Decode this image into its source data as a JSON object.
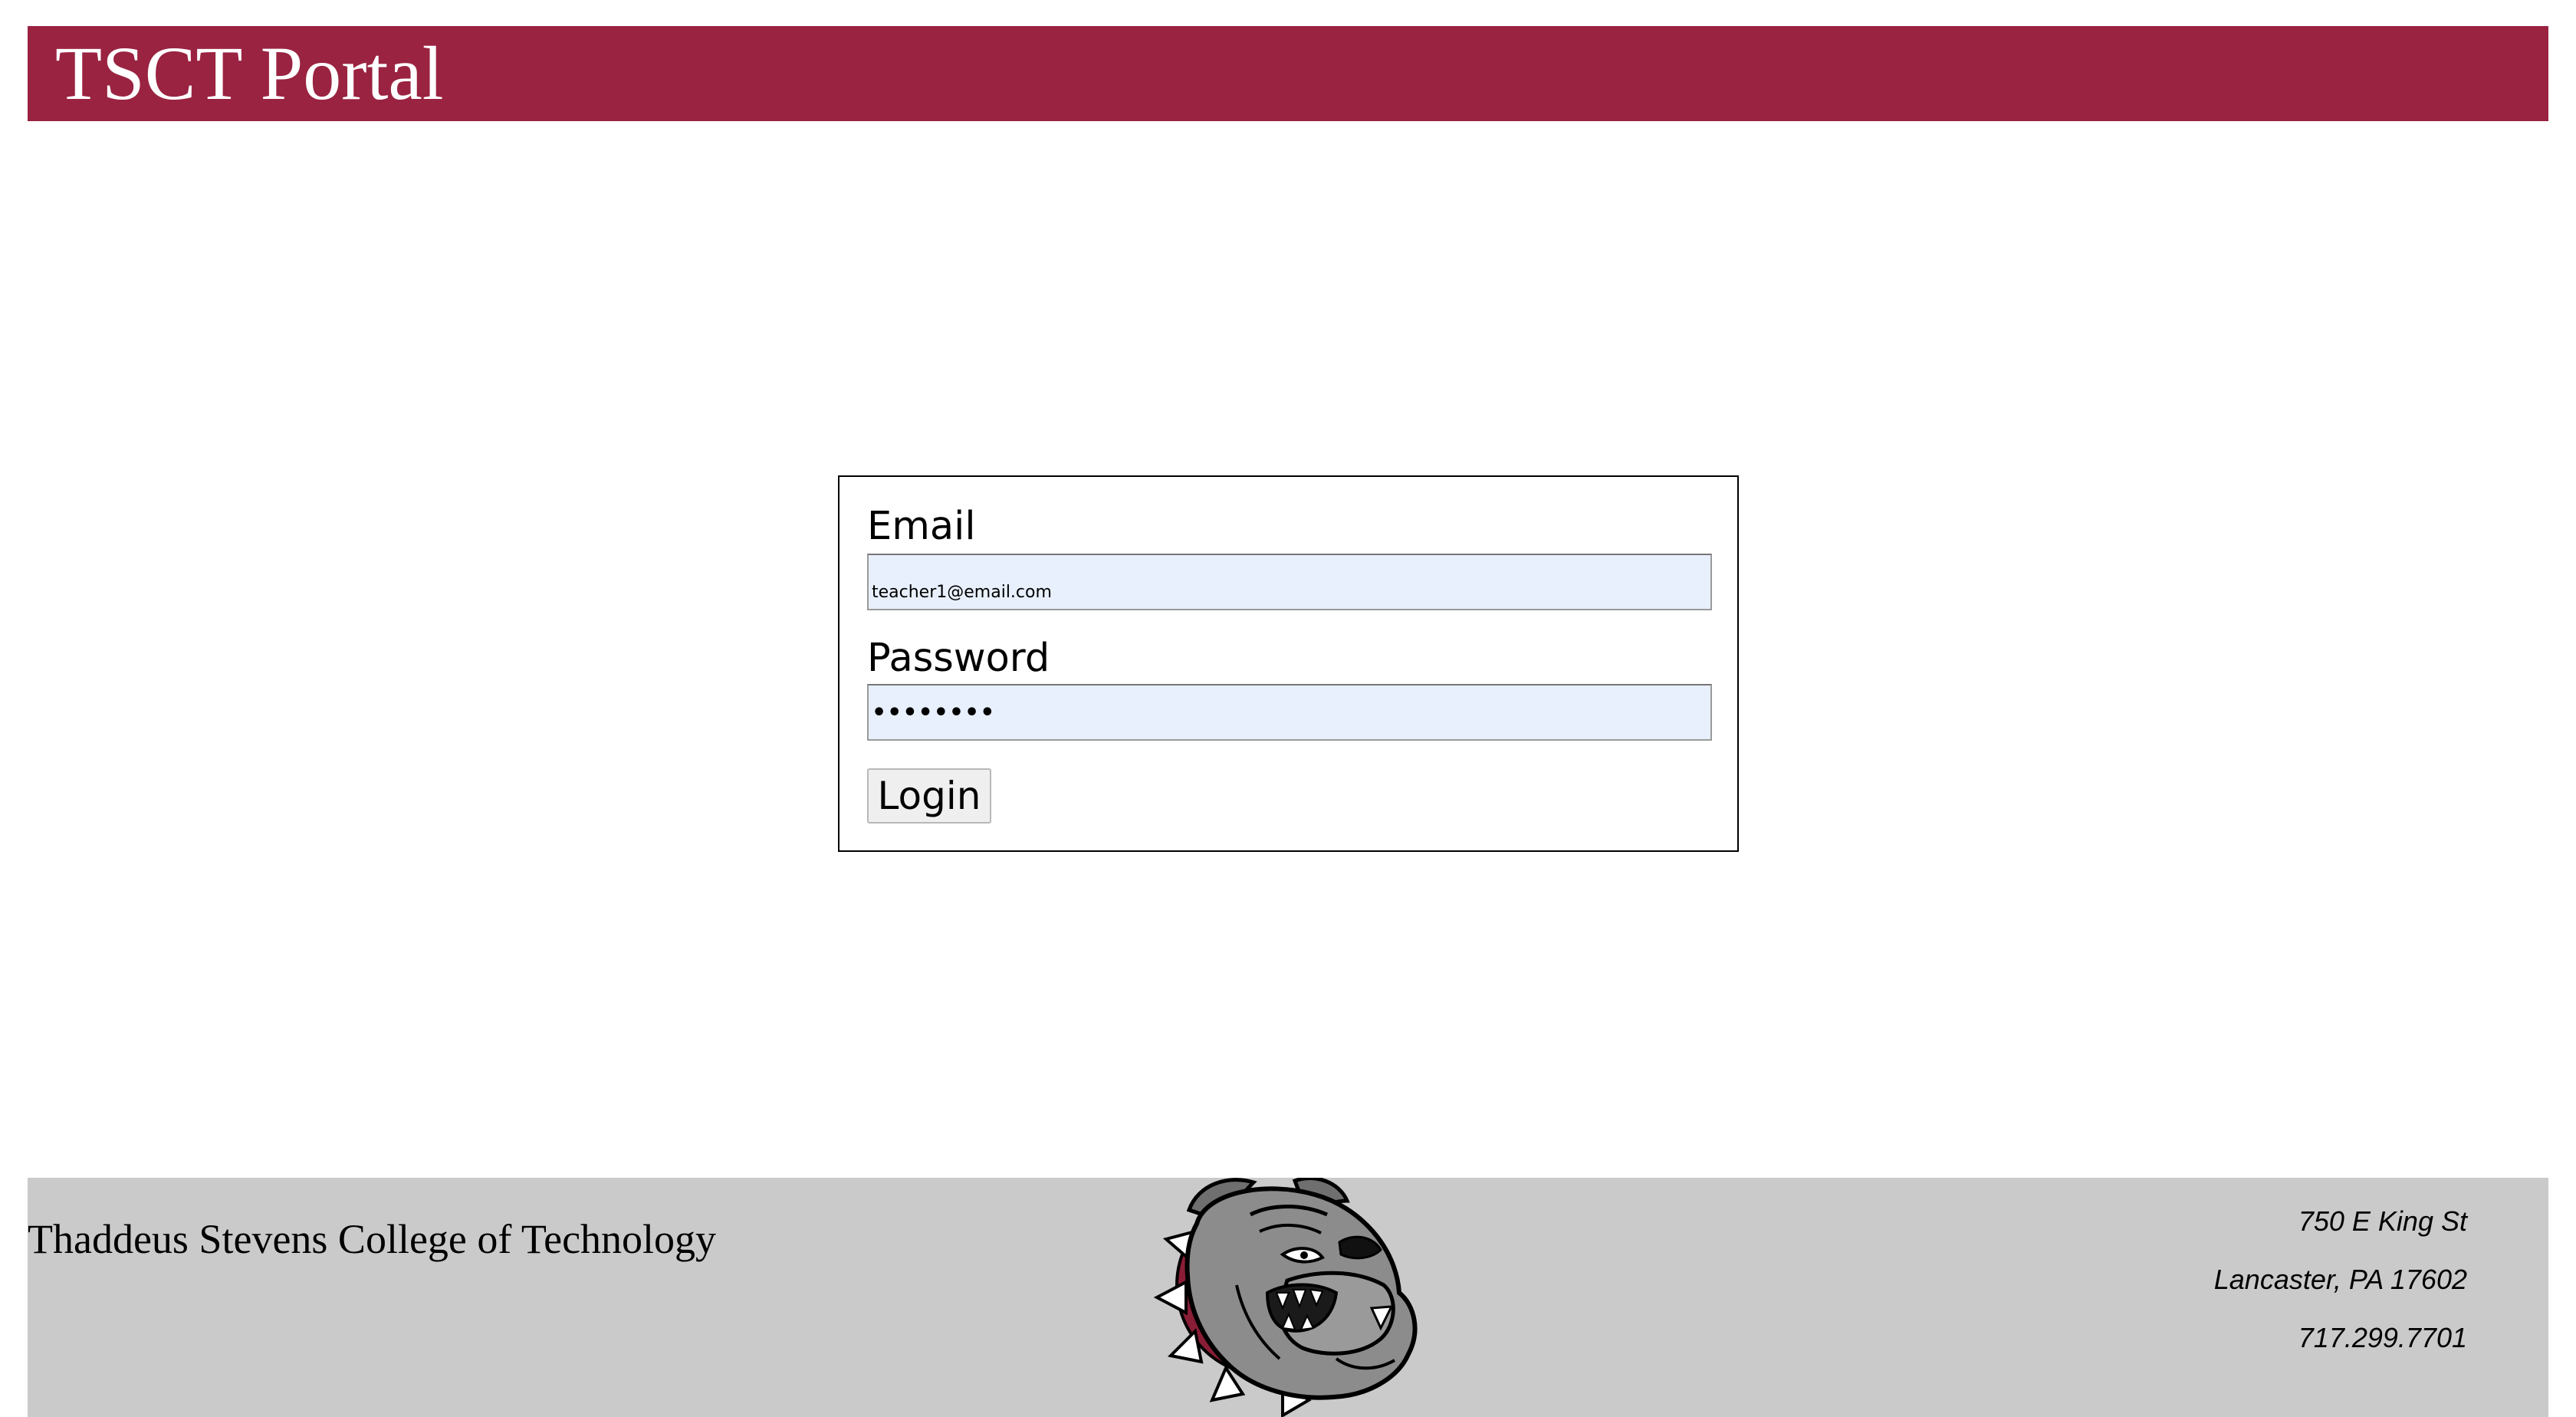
{
  "header": {
    "title": "TSCT Portal",
    "background_color": "#9a2341"
  },
  "login_form": {
    "email_label": "Email",
    "email_value": "teacher1@email.com",
    "password_label": "Password",
    "password_value": "Teacher1",
    "login_label": "Login",
    "autofill_color": "#e8f0fe"
  },
  "footer": {
    "college_name": "Thaddeus Stevens College of Technology",
    "mascot_icon": "bulldog-mascot-icon",
    "address_line1": "750 E King St",
    "address_line2": "Lancaster, PA 17602",
    "phone": "717.299.7701",
    "background_color": "#cacaca"
  }
}
